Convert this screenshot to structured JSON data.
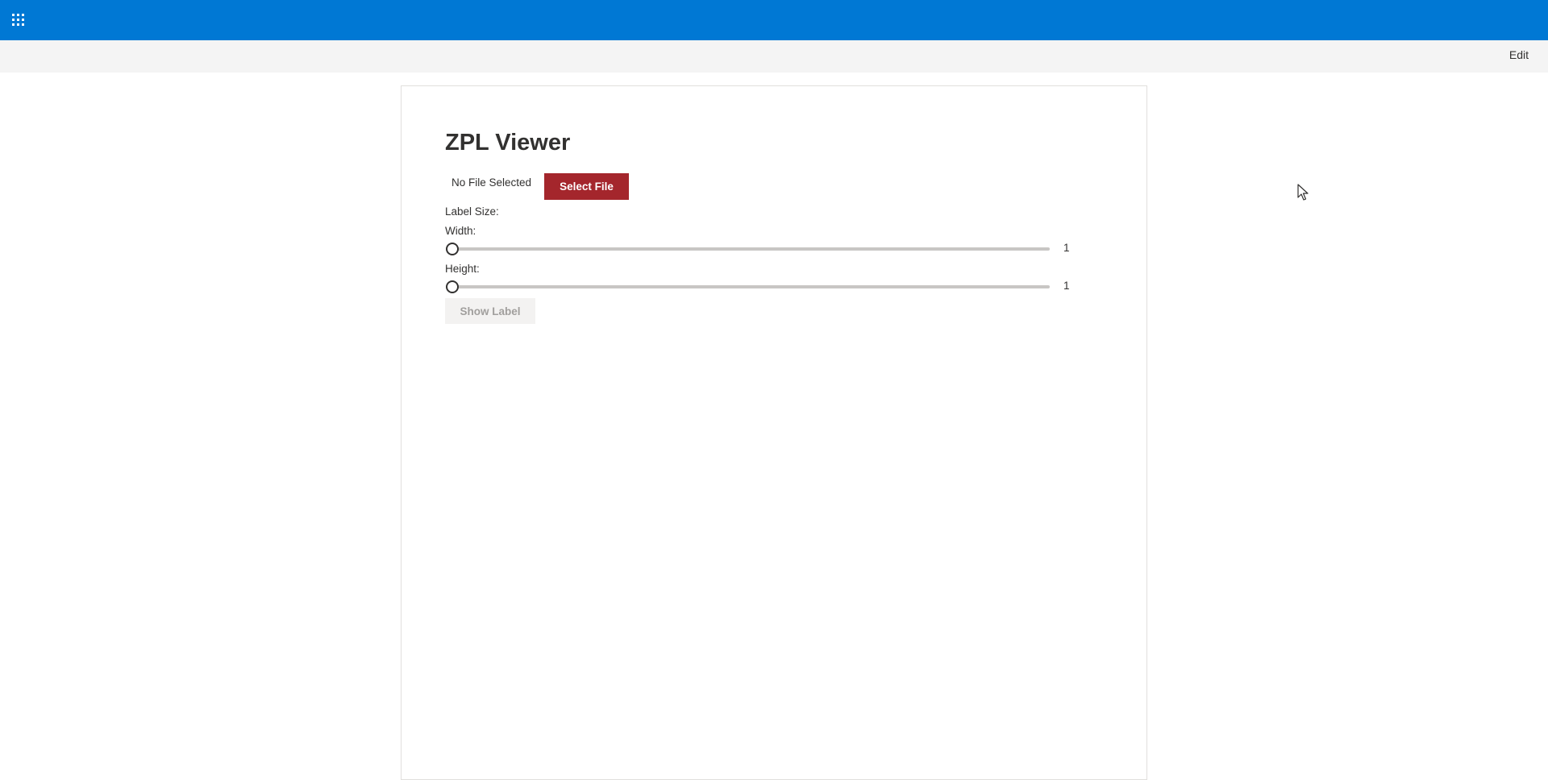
{
  "suite_bar": {
    "color": "#0078d4",
    "app_launcher_icon": "waffle-icon"
  },
  "command_bar": {
    "edit_label": "Edit"
  },
  "zpl_viewer": {
    "title": "ZPL Viewer",
    "file_status": "No File Selected",
    "select_file_label": "Select File",
    "label_size_heading": "Label Size:",
    "width": {
      "label": "Width:",
      "value": "1",
      "level": 0
    },
    "height": {
      "label": "Height:",
      "value": "1",
      "level": 0
    },
    "show_label_button": "Show Label",
    "accent_color": "#a4262c"
  }
}
